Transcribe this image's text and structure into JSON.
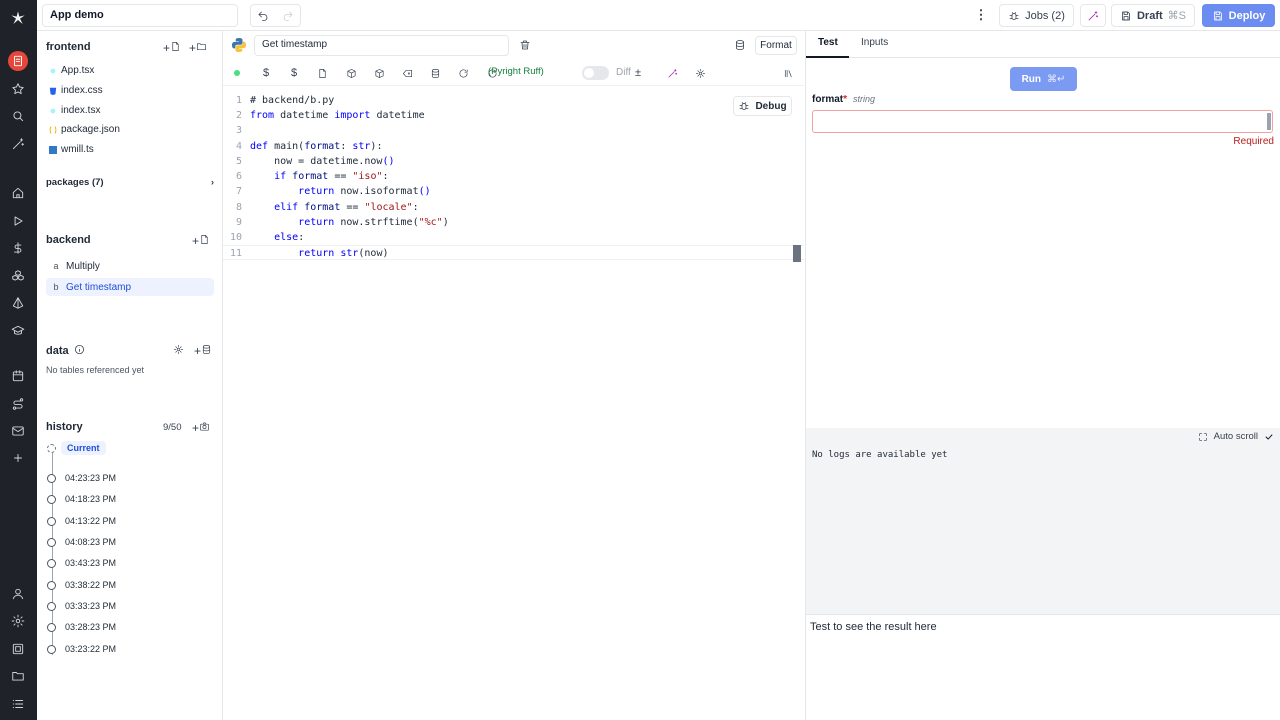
{
  "app": {
    "title": "App demo"
  },
  "topbar": {
    "jobs_label": "Jobs (2)",
    "draft_label": "Draft",
    "draft_shortcut": "⌘S",
    "deploy_label": "Deploy"
  },
  "sidebar": {
    "frontend": {
      "title": "frontend",
      "files": [
        {
          "name": "App.tsx",
          "icon": "react-icon",
          "color": "#22d3ee"
        },
        {
          "name": "index.css",
          "icon": "css-icon",
          "color": "#2563eb"
        },
        {
          "name": "index.tsx",
          "icon": "react-icon",
          "color": "#22d3ee"
        },
        {
          "name": "package.json",
          "icon": "json-icon",
          "color": "#eab308"
        },
        {
          "name": "wmill.ts",
          "icon": "typescript-icon",
          "color": "#3178c6"
        }
      ],
      "packages_label": "packages (7)"
    },
    "backend": {
      "title": "backend",
      "runnables": [
        {
          "letter": "a",
          "name": "Multiply"
        },
        {
          "letter": "b",
          "name": "Get timestamp"
        }
      ]
    },
    "data": {
      "title": "data",
      "empty_text": "No tables referenced yet"
    },
    "history": {
      "title": "history",
      "count": "9/50",
      "current_label": "Current",
      "items": [
        "04:23:23 PM",
        "04:18:23 PM",
        "04:13:22 PM",
        "04:08:23 PM",
        "03:43:23 PM",
        "03:38:22 PM",
        "03:33:23 PM",
        "03:28:23 PM",
        "03:23:22 PM"
      ]
    }
  },
  "editor": {
    "runnable_name": "Get timestamp",
    "format_label": "Format",
    "lsp_label": "(Pyright Ruff)",
    "diff_label": "Diff",
    "debug_label": "Debug",
    "code_lines": [
      "# backend/b.py",
      "from datetime import datetime",
      "",
      "def main(format: str):",
      "    now = datetime.now()",
      "    if format == \"iso\":",
      "        return now.isoformat()",
      "    elif format == \"locale\":",
      "        return now.strftime(\"%c\")",
      "    else:",
      "        return str(now)"
    ]
  },
  "right": {
    "tabs": [
      "Test",
      "Inputs"
    ],
    "run_label": "Run",
    "run_shortcut": "⌘↵",
    "arg": {
      "name": "format",
      "type": "string",
      "error": "Required"
    },
    "logs": {
      "autoscroll_label": "Auto scroll",
      "empty_text": "No logs are available yet"
    },
    "result_text": "Test to see the result here"
  },
  "colors": {
    "accent": "#6b8cf0",
    "rail": "#1f2329",
    "active_rail_item": "#e5483b",
    "error": "#b91c1c"
  }
}
